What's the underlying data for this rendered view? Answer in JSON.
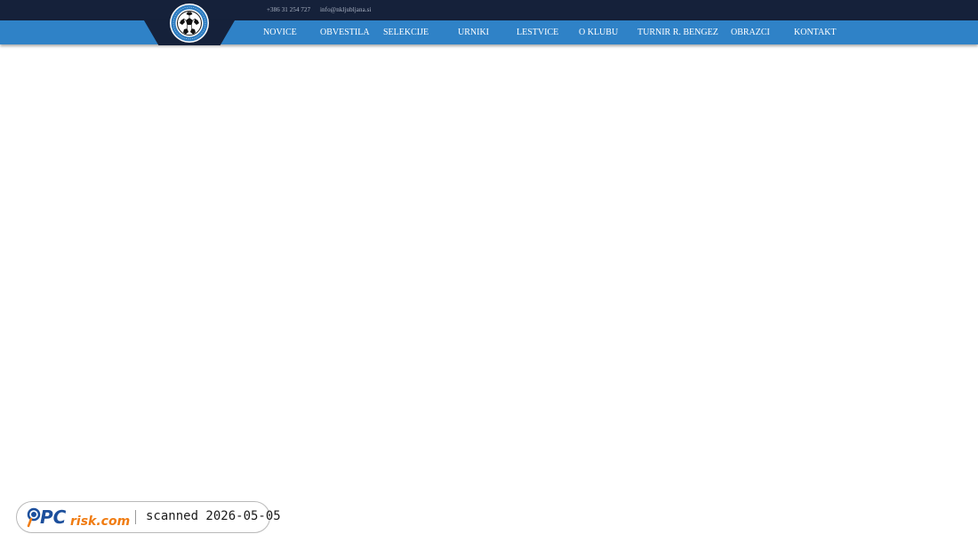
{
  "header": {
    "phone": "+386 31 254 727",
    "email": "info@nkljubljana.si",
    "logo_icon": "club-crest-soccer-ball-icon"
  },
  "nav": {
    "items": [
      {
        "label": "NOVICE"
      },
      {
        "label": "OBVESTILA"
      },
      {
        "label": "SELEKCIJE"
      },
      {
        "label": "URNIKI"
      },
      {
        "label": "LESTVICE"
      },
      {
        "label": "O KLUBU"
      },
      {
        "label": "TURNIR R. BENGEZ"
      },
      {
        "label": "OBRAZCI"
      },
      {
        "label": "KONTAKT"
      }
    ]
  },
  "watermark": {
    "brand": "PCrisk.com",
    "text": "scanned 2026-05-05"
  },
  "colors": {
    "topbar": "#15213a",
    "navbar": "#2f82c7",
    "nav_text": "#ffffff",
    "brand_blue": "#1c4f9c",
    "brand_orange": "#f07c12"
  }
}
